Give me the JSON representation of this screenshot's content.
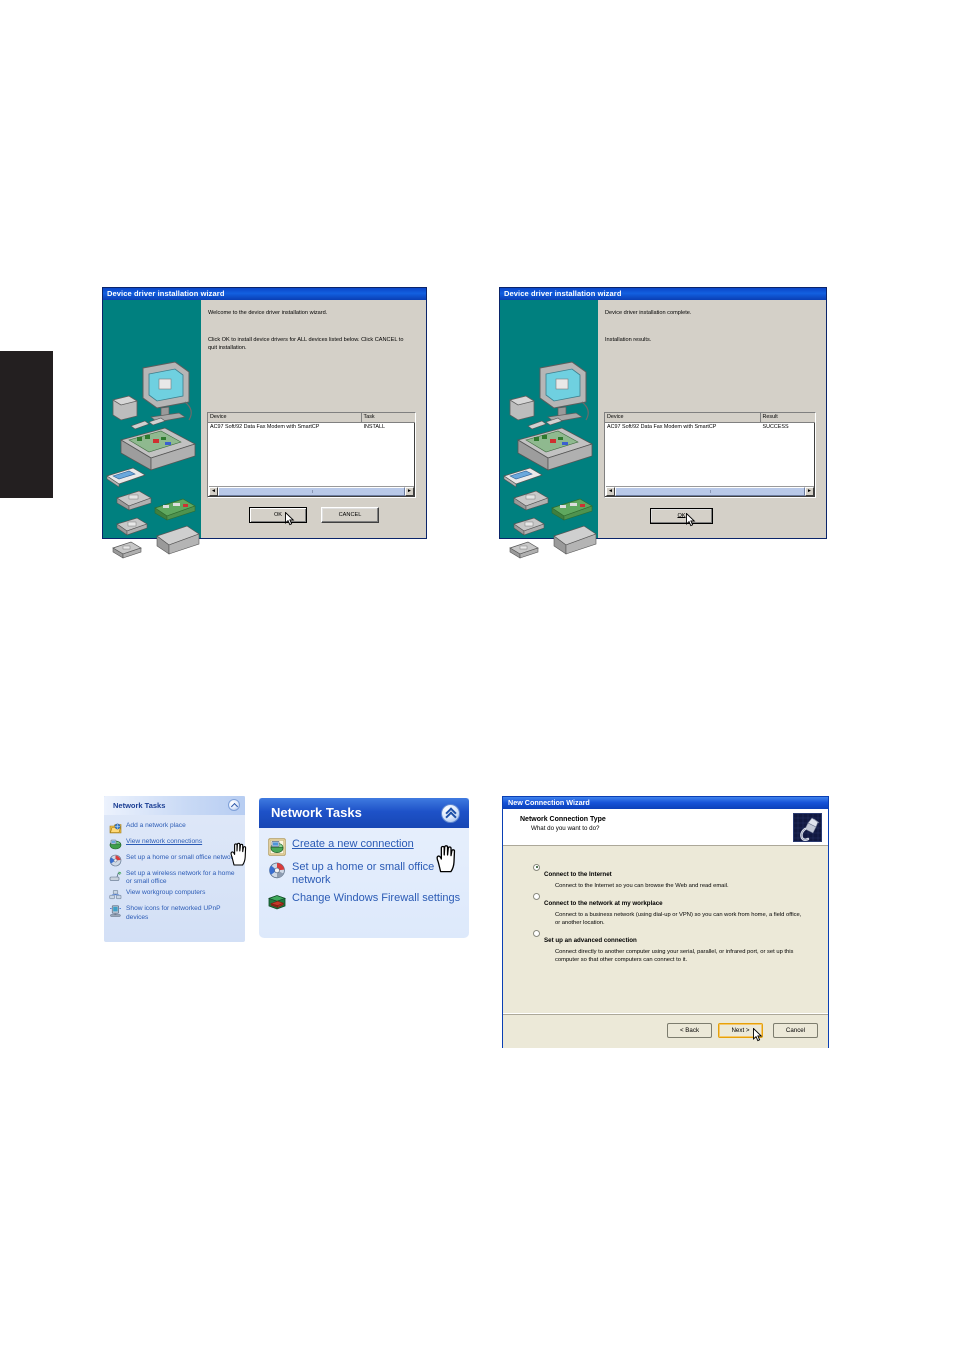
{
  "page": {
    "background": "#ffffff",
    "black_tab_color": "#231f20"
  },
  "dialog_install": {
    "title": "Device driver installation wizard",
    "title_bar_color": "#0a46c8",
    "sidebar_color": "#00807f",
    "sidebar_icon": "computer-hardware-exploded-icon",
    "intro_text": "Welcome to the device driver installation wizard.",
    "instruction_text": "Click OK to install device drivers for ALL devices listed below. Click CANCEL to quit installation.",
    "list": {
      "columns": [
        "Device",
        "Task"
      ],
      "rows": [
        {
          "device": "AC97 Soft/92 Data Fax Modem with SmartCP",
          "task": "INSTALL"
        }
      ]
    },
    "scrollbar": {
      "left_arrow": "◄",
      "right_arrow": "►"
    },
    "buttons": {
      "ok": "OK",
      "cancel": "CANCEL"
    },
    "cursor": "mouse-pointer-on-ok"
  },
  "dialog_complete": {
    "title": "Device driver installation wizard",
    "title_bar_color": "#0a46c8",
    "sidebar_color": "#00807f",
    "sidebar_icon": "computer-hardware-exploded-icon",
    "intro_text": "Device driver installation complete.",
    "instruction_text": "Installation results.",
    "list": {
      "columns": [
        "Device",
        "Result"
      ],
      "rows": [
        {
          "device": "AC97 Soft/92 Data Fax Modem with SmartCP",
          "task": "SUCCESS"
        }
      ]
    },
    "scrollbar": {
      "left_arrow": "◄",
      "right_arrow": "►"
    },
    "buttons": {
      "ok": "OK"
    },
    "cursor": "mouse-pointer-on-ok"
  },
  "panel_small": {
    "title": "Network Tasks",
    "collapse_icon": "chevron-up-circle-icon",
    "items": [
      {
        "label": "Add a network place",
        "icon": "add-network-place-icon",
        "link": false
      },
      {
        "label": "View network connections",
        "icon": "network-connections-icon",
        "link": true
      },
      {
        "label": "Set up a home or small office network",
        "icon": "home-network-wizard-icon",
        "link": false
      },
      {
        "label": "Set up a wireless network for a home or small office",
        "icon": "wireless-network-icon",
        "link": false
      },
      {
        "label": "View workgroup computers",
        "icon": "workgroup-computers-icon",
        "link": false
      },
      {
        "label": "Show icons for networked UPnP devices",
        "icon": "upnp-devices-icon",
        "link": false
      }
    ],
    "cursor": "hand-pointer"
  },
  "panel_large": {
    "title": "Network Tasks",
    "header_color": "#1e52c8",
    "collapse_icon": "chevron-up-circle-icon",
    "items": [
      {
        "label": "Create a new connection",
        "icon": "new-connection-icon",
        "link": true
      },
      {
        "label": "Set up a home or small office network",
        "icon": "home-network-wizard-icon",
        "link": false
      },
      {
        "label": "Change Windows Firewall settings",
        "icon": "windows-firewall-icon",
        "link": false
      }
    ],
    "cursor": "hand-pointer"
  },
  "wizard": {
    "title": "New Connection Wizard",
    "heading": "Network Connection Type",
    "subheading": "What do you want to do?",
    "banner_icon": "network-cable-plug-icon",
    "options": [
      {
        "label": "Connect to the Internet",
        "description": "Connect to the Internet so you can browse the Web and read email.",
        "selected": true
      },
      {
        "label": "Connect to the network at my workplace",
        "description": "Connect to a business network (using dial-up or VPN) so you can work from home, a field office, or another location.",
        "selected": false
      },
      {
        "label": "Set up an advanced connection",
        "description": "Connect directly to another computer using your serial, parallel, or infrared port, or set up this computer so that other computers can connect to it.",
        "selected": false
      }
    ],
    "buttons": {
      "back": "< Back",
      "next": "Next >",
      "cancel": "Cancel"
    },
    "cursor": "mouse-pointer-on-next"
  }
}
